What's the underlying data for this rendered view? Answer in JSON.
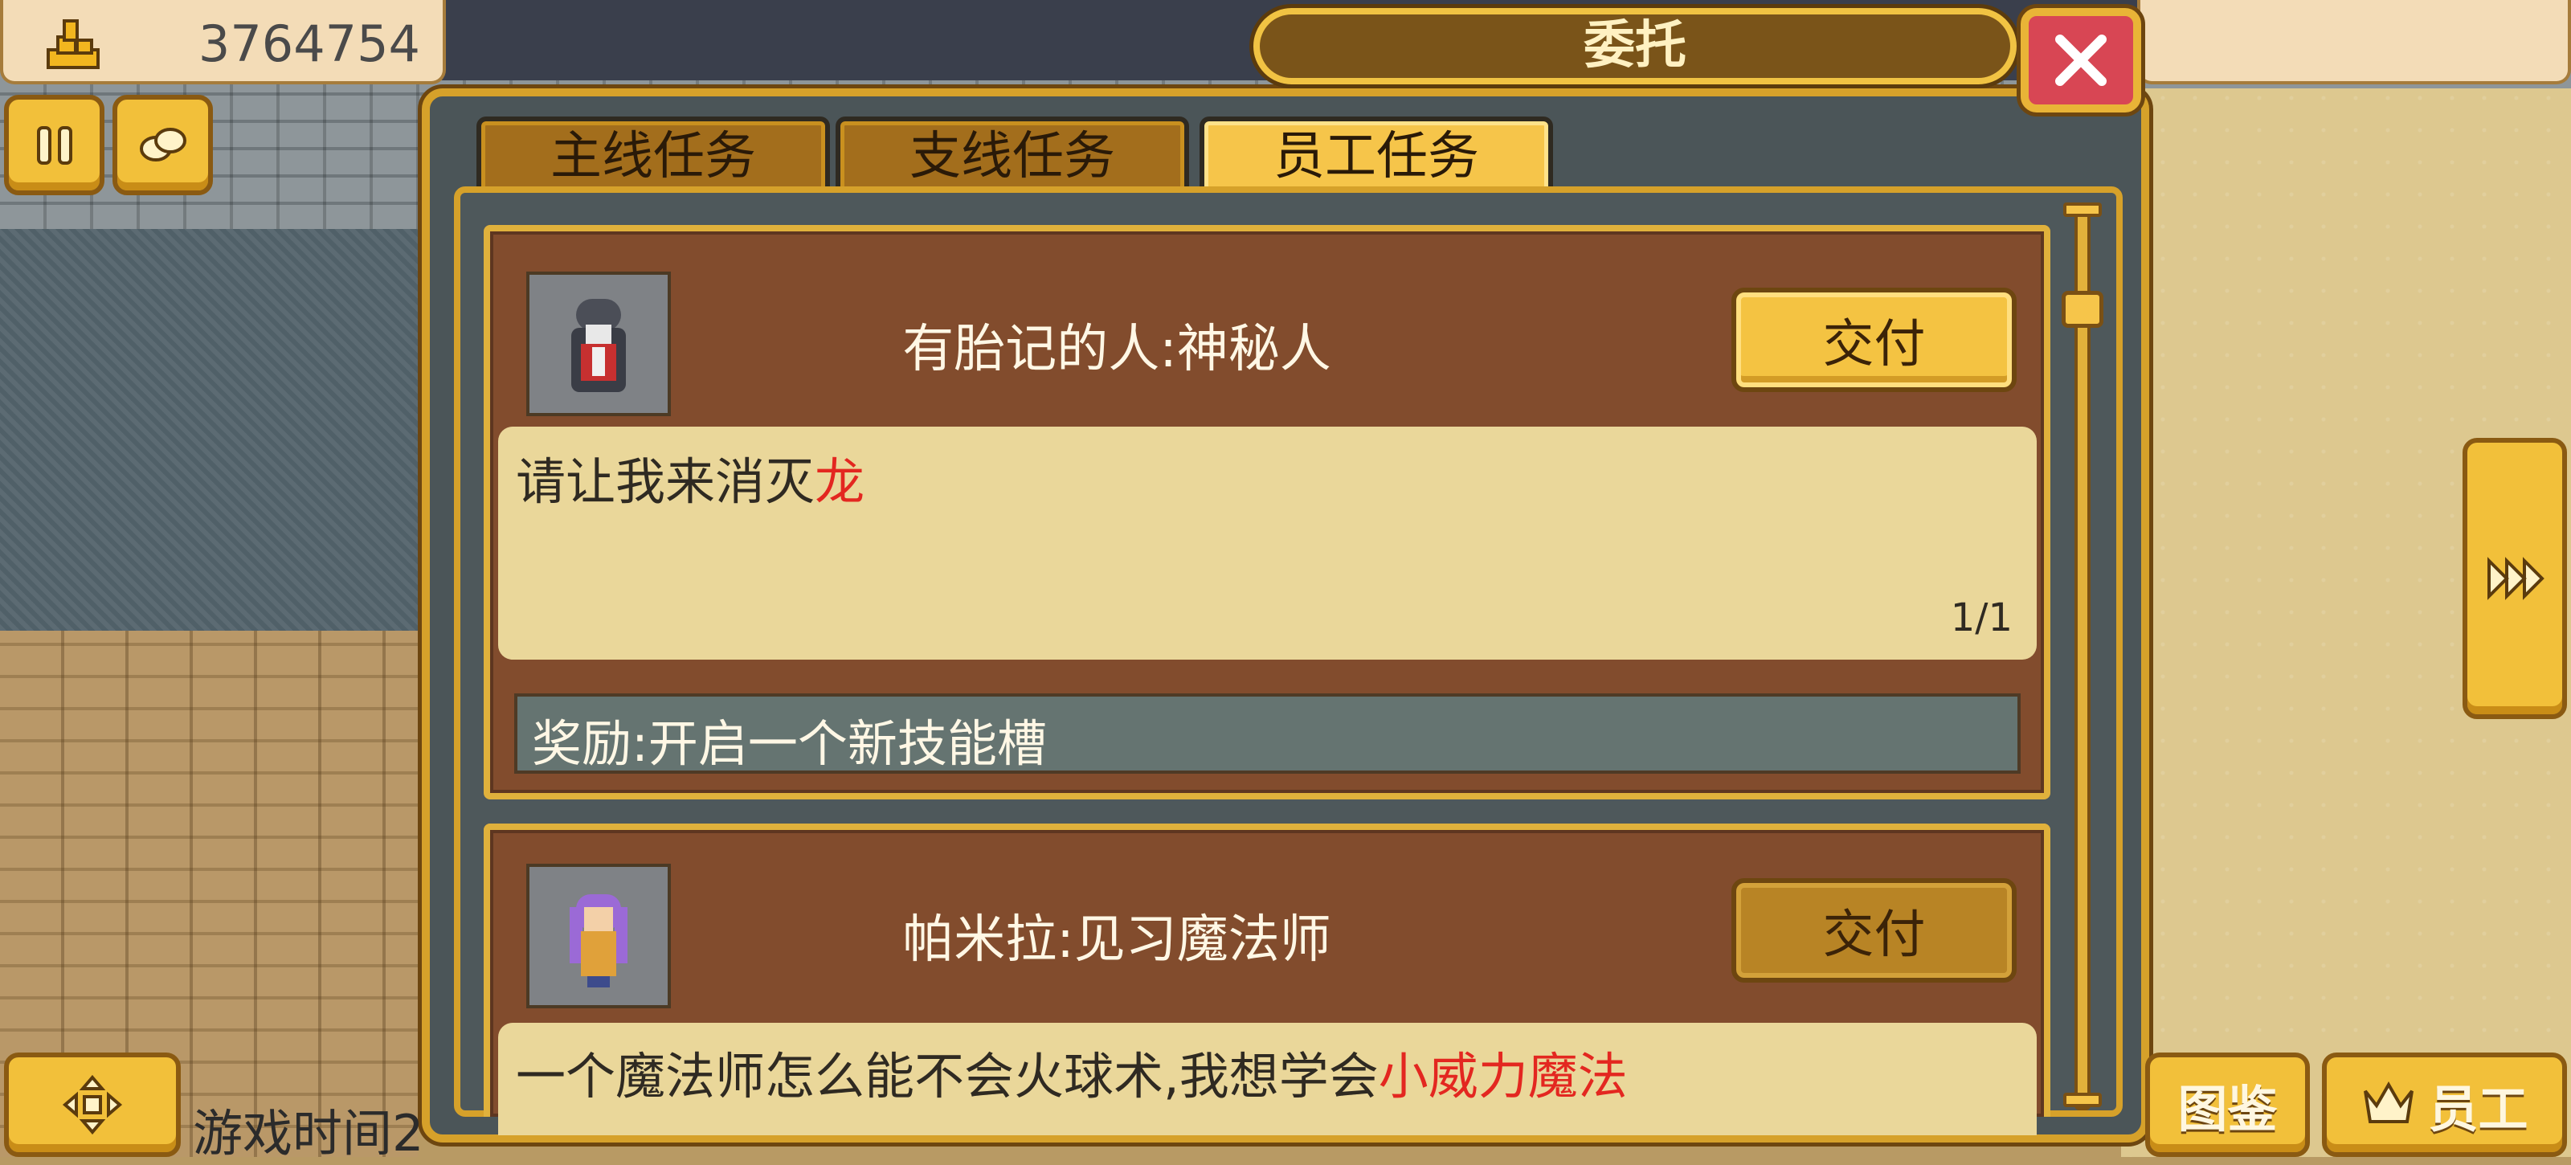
{
  "hud": {
    "money_value": "3764754",
    "money_icon": "gold-stack-icon",
    "pause_icon": "pause-icon",
    "menu_icon": "scroll-icon"
  },
  "dialog": {
    "title": "委托",
    "close_icon": "close-icon",
    "tabs": [
      {
        "label": "主线任务",
        "active": false
      },
      {
        "label": "支线任务",
        "active": false
      },
      {
        "label": "员工任务",
        "active": true
      }
    ]
  },
  "quests": [
    {
      "name": "有胎记的人:神秘人",
      "deliver_label": "交付",
      "deliver_enabled": true,
      "description": "请让我来消灭",
      "highlight": "龙",
      "progress": "1/1",
      "reward": "奖励:开启一个新技能槽",
      "portrait": "hooded-figure-portrait"
    },
    {
      "name": "帕米拉:见习魔法师",
      "deliver_label": "交付",
      "deliver_enabled": false,
      "description": "一个魔法师怎么能不会火球术,我想学会",
      "highlight": "小威力魔法",
      "portrait": "purple-hair-mage-portrait"
    }
  ],
  "footer": {
    "game_time": "游戏时间2",
    "catalog_label": "图鉴",
    "staff_label": "员工",
    "dpad_icon": "dpad-icon",
    "crown_icon": "crown-icon",
    "next_icon": "fast-forward-icon"
  },
  "colors": {
    "gold": "#f2c03a",
    "panel_brown": "#824c2d",
    "desc_bg": "#ead79a",
    "highlight_red": "#e32720",
    "close_red": "#d84654"
  }
}
